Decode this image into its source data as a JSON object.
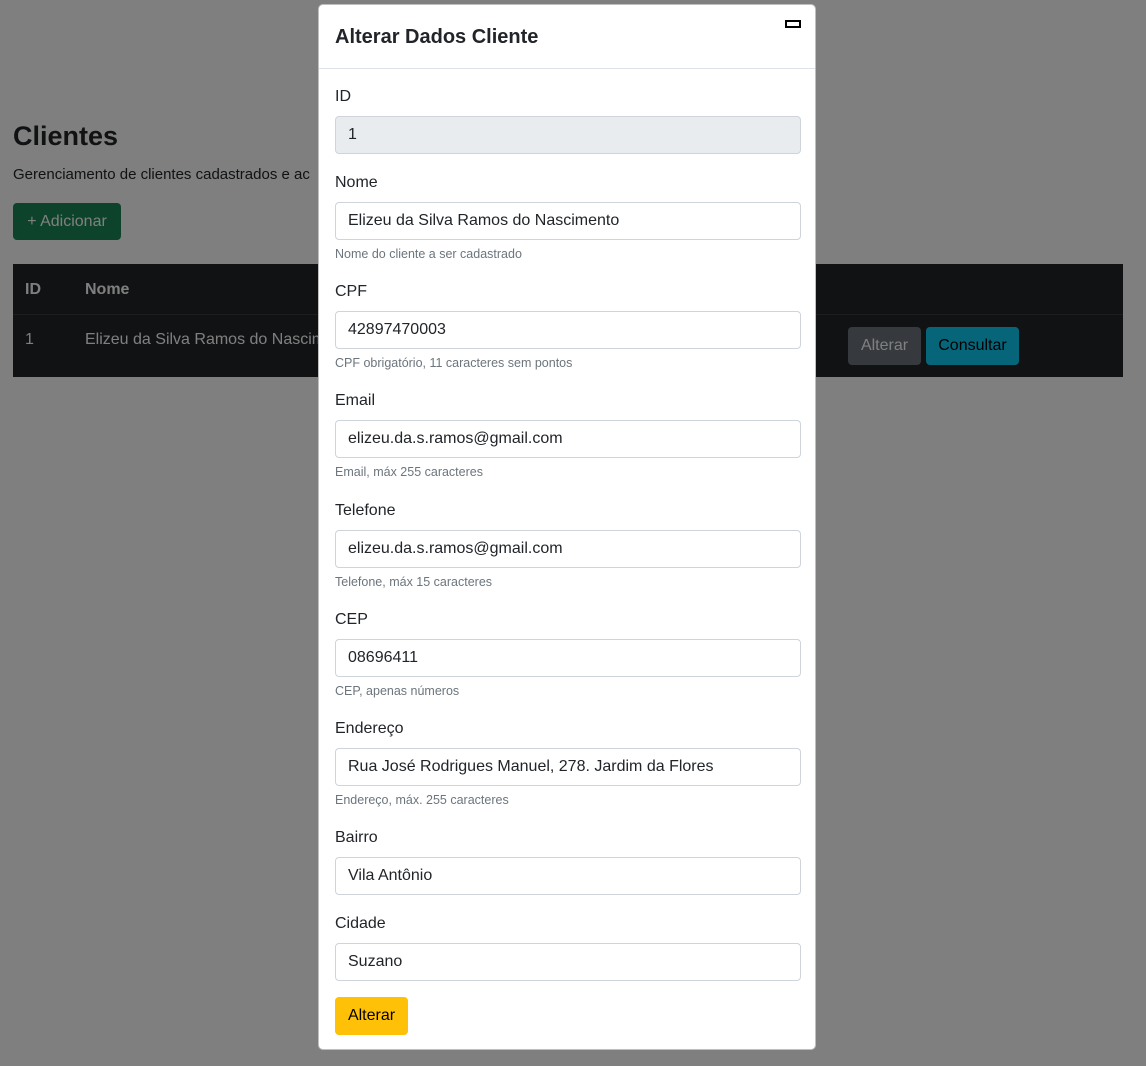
{
  "page": {
    "title": "Clientes",
    "subtitle": "Gerenciamento de clientes cadastrados e ac",
    "add_button": "+ Adicionar"
  },
  "table": {
    "headers": [
      "ID",
      "Nome"
    ],
    "rows": [
      {
        "id": "1",
        "nome": "Elizeu da Silva Ramos do Nascime",
        "alterar": "Alterar",
        "consultar": "Consultar"
      }
    ]
  },
  "modal": {
    "title": "Alterar Dados Cliente",
    "close_icon": "minimize-icon",
    "fields": [
      {
        "label": "ID",
        "value": "1",
        "readonly": true,
        "help": ""
      },
      {
        "label": "Nome",
        "value": "Elizeu da Silva Ramos do Nascimento",
        "help": "Nome do cliente a ser cadastrado"
      },
      {
        "label": "CPF",
        "value": "42897470003",
        "help": "CPF obrigatório, 11 caracteres sem pontos"
      },
      {
        "label": "Email",
        "value": "elizeu.da.s.ramos@gmail.com",
        "help": "Email, máx 255 caracteres"
      },
      {
        "label": "Telefone",
        "value": "elizeu.da.s.ramos@gmail.com",
        "help": "Telefone, máx 15 caracteres"
      },
      {
        "label": "CEP",
        "value": "08696411",
        "help": "CEP, apenas números"
      },
      {
        "label": "Endereço",
        "value": "Rua José Rodrigues Manuel, 278. Jardim da Flores",
        "help": "Endereço, máx. 255 caracteres"
      },
      {
        "label": "Bairro",
        "value": "Vila Antônio",
        "help": ""
      },
      {
        "label": "Cidade",
        "value": "Suzano",
        "help": ""
      }
    ],
    "submit_label": "Alterar"
  },
  "colors": {
    "success": "#198754",
    "secondary": "#6c757d",
    "info": "#0dcaf0",
    "warning": "#ffc107",
    "dark": "#212529"
  }
}
